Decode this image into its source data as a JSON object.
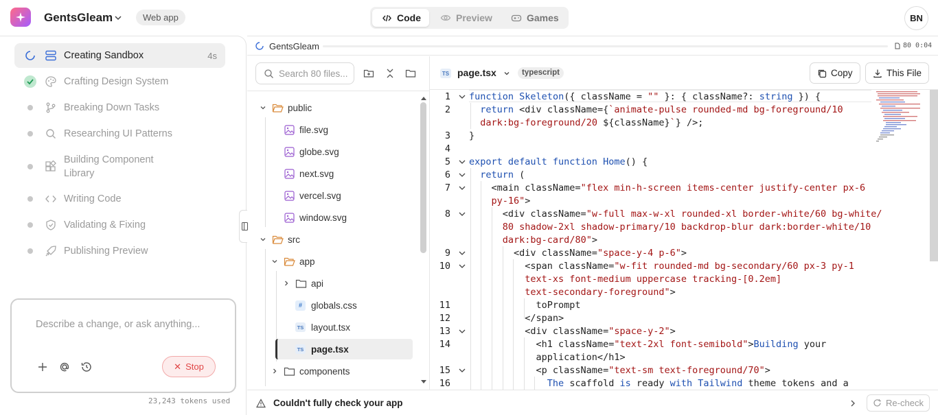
{
  "header": {
    "app_name": "GentsGleam",
    "badge": "Web app",
    "tabs": [
      {
        "label": "Code",
        "active": true
      },
      {
        "label": "Preview",
        "active": false
      },
      {
        "label": "Games",
        "active": false
      }
    ],
    "avatar_initials": "BN"
  },
  "steps": [
    {
      "label": "Creating Sandbox",
      "status": "running",
      "time": "4s",
      "icon": "layout-icon"
    },
    {
      "label": "Crafting Design System",
      "status": "done",
      "icon": "palette-icon"
    },
    {
      "label": "Breaking Down Tasks",
      "status": "pending",
      "icon": "branch-icon"
    },
    {
      "label": "Researching UI Patterns",
      "status": "pending",
      "icon": "search-icon"
    },
    {
      "label": "Building Component Library",
      "status": "pending",
      "icon": "blocks-icon"
    },
    {
      "label": "Writing Code",
      "status": "pending",
      "icon": "code-icon"
    },
    {
      "label": "Validating & Fixing",
      "status": "pending",
      "icon": "shield-icon"
    },
    {
      "label": "Publishing Preview",
      "status": "pending",
      "icon": "rocket-icon"
    }
  ],
  "chat": {
    "placeholder": "Describe a change, or ask anything...",
    "stop_label": "Stop",
    "tokens": "23,243 tokens used"
  },
  "sandbox": {
    "title": "GentsGleam",
    "counter": "80 0:04"
  },
  "file_tree": {
    "search_placeholder": "Search 80 files...",
    "nodes": [
      {
        "name": "public",
        "type": "folder",
        "open": true,
        "depth": 0
      },
      {
        "name": "file.svg",
        "type": "image",
        "depth": 1
      },
      {
        "name": "globe.svg",
        "type": "image",
        "depth": 1
      },
      {
        "name": "next.svg",
        "type": "image",
        "depth": 1
      },
      {
        "name": "vercel.svg",
        "type": "image",
        "depth": 1
      },
      {
        "name": "window.svg",
        "type": "image",
        "depth": 1
      },
      {
        "name": "src",
        "type": "folder",
        "open": true,
        "depth": 0
      },
      {
        "name": "app",
        "type": "folder",
        "open": true,
        "depth": 1
      },
      {
        "name": "api",
        "type": "folder",
        "open": false,
        "depth": 2
      },
      {
        "name": "globals.css",
        "type": "css",
        "depth": 2
      },
      {
        "name": "layout.tsx",
        "type": "ts",
        "depth": 2
      },
      {
        "name": "page.tsx",
        "type": "ts",
        "depth": 2,
        "selected": true
      },
      {
        "name": "components",
        "type": "folder",
        "open": false,
        "depth": 1
      }
    ]
  },
  "editor": {
    "file_name": "page.tsx",
    "language": "typescript",
    "ts_badge": "TS",
    "copy_label": "Copy",
    "download_label": "This File",
    "line_numbers": [
      "1",
      "2",
      "3",
      "4",
      "5",
      "6",
      "7",
      "8",
      "9",
      "10",
      "11",
      "12",
      "13",
      "14",
      "15",
      "16"
    ]
  },
  "status_bar": {
    "message": "Couldn't fully check your app",
    "recheck_label": "Re-check"
  }
}
